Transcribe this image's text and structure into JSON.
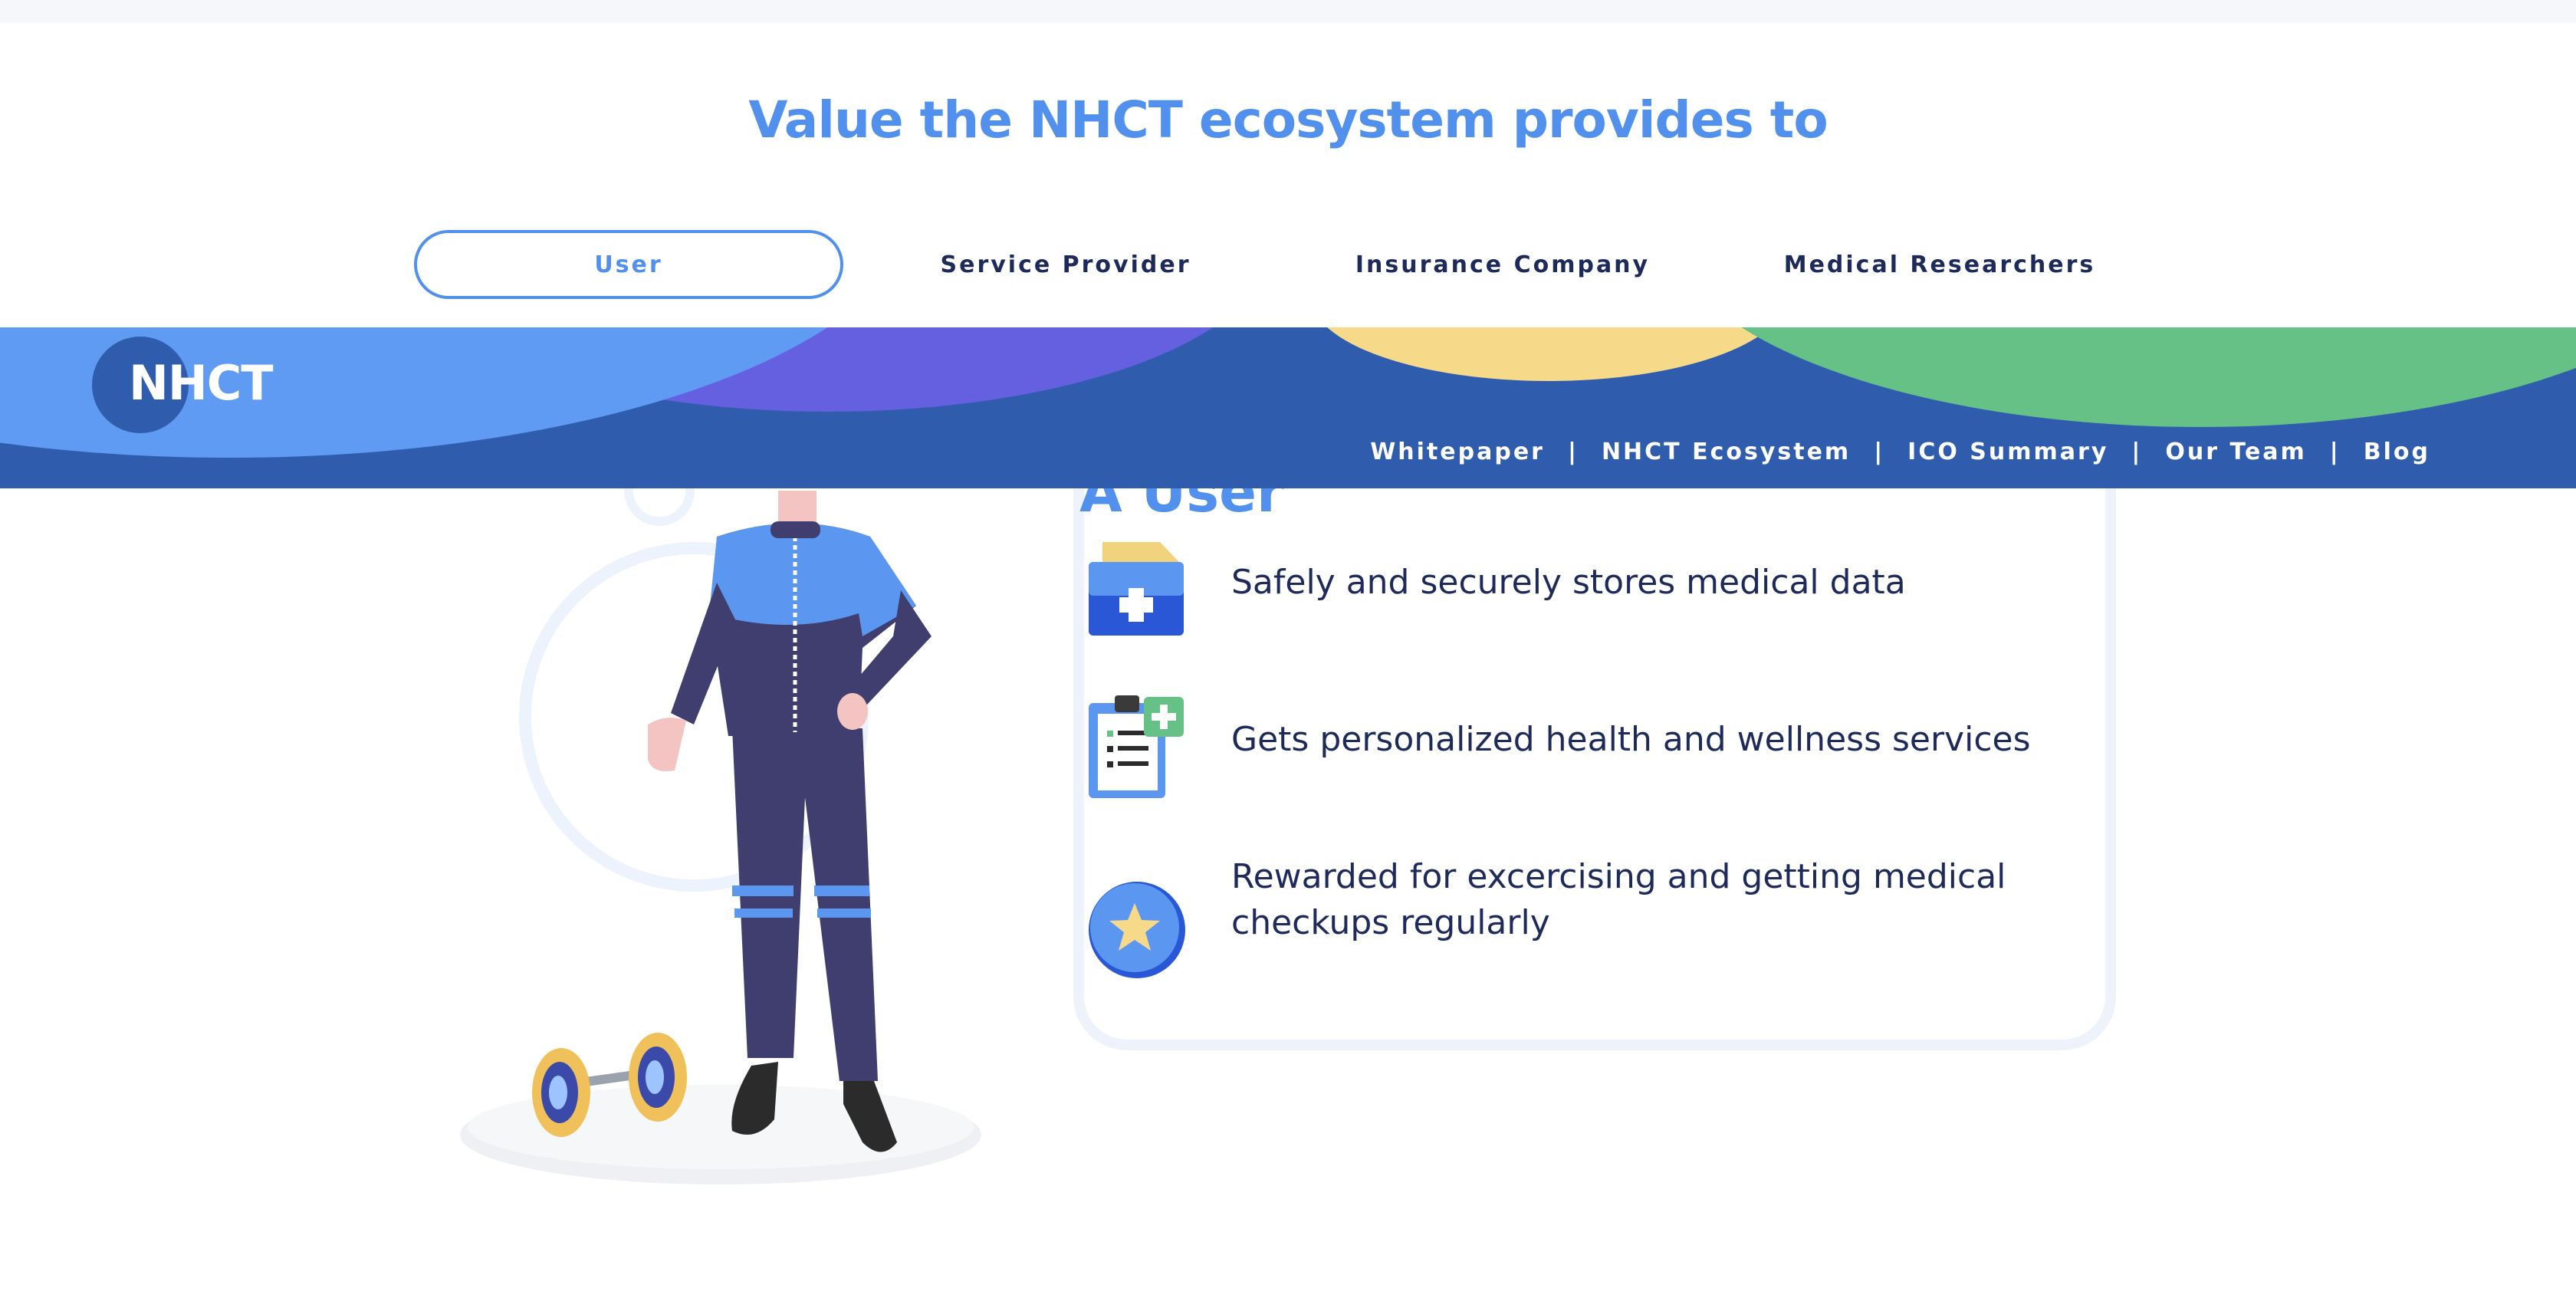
{
  "section": {
    "title": "Value the NHCT ecosystem provides to"
  },
  "tabs": [
    {
      "label": "User",
      "active": true
    },
    {
      "label": "Service Provider",
      "active": false
    },
    {
      "label": "Insurance Company",
      "active": false
    },
    {
      "label": "Medical Researchers",
      "active": false
    }
  ],
  "header": {
    "logo_text": "NHCT",
    "nav": [
      "Whitepaper",
      "NHCT Ecosystem",
      "ICO Summary",
      "Our Team",
      "Blog"
    ],
    "separator": "|"
  },
  "card": {
    "title": "A User",
    "benefits": [
      {
        "icon": "medical-folder-icon",
        "text": "Safely and securely stores medical data"
      },
      {
        "icon": "clipboard-checklist-icon",
        "text": "Gets personalized health and wellness services"
      },
      {
        "icon": "star-badge-icon",
        "text": "Rewarded for excercising and getting medical checkups regularly"
      }
    ]
  },
  "colors": {
    "accent": "#5190ec",
    "header_dark": "#2f5cad",
    "header_light": "#5f9af3",
    "purple": "#6560e0",
    "yellow": "#f7d98a",
    "green": "#66c186",
    "text_dark": "#1e2a5a"
  }
}
